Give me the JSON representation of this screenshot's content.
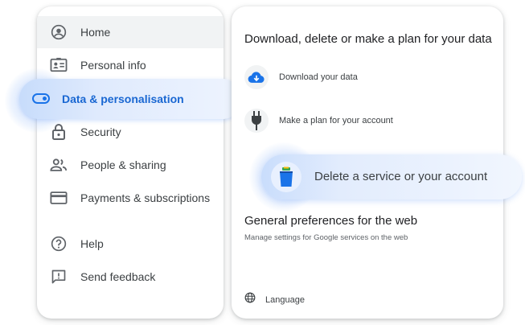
{
  "nav": {
    "items": [
      {
        "label": "Home",
        "icon": "account-circle-icon"
      },
      {
        "label": "Personal info",
        "icon": "id-card-icon"
      },
      {
        "label": "Data & personalisation",
        "icon": "toggle-icon",
        "active": true
      },
      {
        "label": "Security",
        "icon": "lock-icon"
      },
      {
        "label": "People & sharing",
        "icon": "people-icon"
      },
      {
        "label": "Payments & subscriptions",
        "icon": "credit-card-icon"
      },
      {
        "label": "Help",
        "icon": "help-icon"
      },
      {
        "label": "Send feedback",
        "icon": "feedback-icon"
      }
    ]
  },
  "data_section": {
    "title": "Download, delete or make a plan for your data",
    "download_label": "Download your data",
    "plan_label": "Make a plan for your account",
    "delete_label": "Delete a service or your account"
  },
  "preferences_section": {
    "title": "General preferences for the web",
    "subtitle": "Manage settings for Google services on the web",
    "language_label": "Language"
  },
  "colors": {
    "accent": "#1a73e8",
    "active_text": "#1967d2",
    "highlight": "#d2e3fc",
    "text": "#3c4043"
  }
}
